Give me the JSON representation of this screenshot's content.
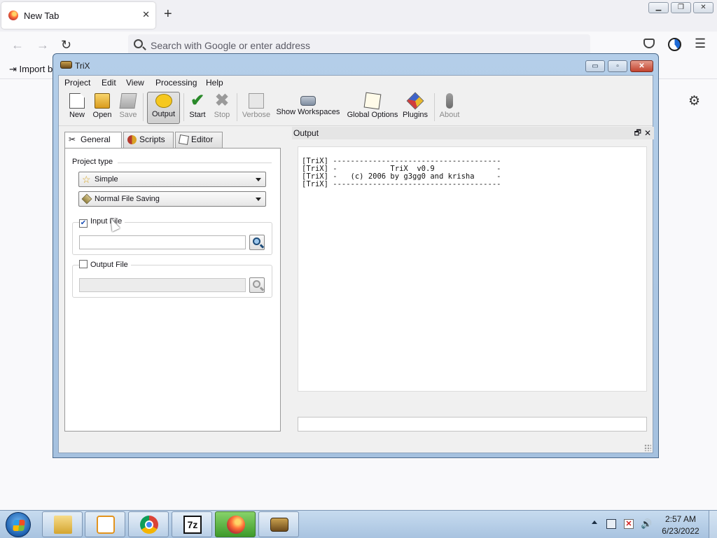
{
  "browser": {
    "tab_title": "New Tab",
    "tab_close": "✕",
    "new_tab": "+",
    "url_placeholder": "Search with Google or enter address",
    "import_bookmarks": "⇥ Import b"
  },
  "trix": {
    "title": "TriX",
    "window_controls": {
      "minimize": "▭",
      "maximize": "▫",
      "close": "✕"
    },
    "menu": [
      "Project",
      "Edit",
      "View",
      "Processing",
      "Help"
    ],
    "toolbar": {
      "new": "New",
      "open": "Open",
      "save": "Save",
      "output": "Output",
      "start": "Start",
      "stop": "Stop",
      "verbose": "Verbose",
      "show_workspaces": "Show Workspaces",
      "global_options": "Global Options",
      "plugins": "Plugins",
      "about": "About"
    },
    "tabs": {
      "general": "General",
      "scripts": "Scripts",
      "editor": "Editor"
    },
    "general": {
      "project_type_label": "Project type",
      "project_type_value": "Simple",
      "file_saving_value": "Normal File Saving",
      "input_file_label": "Input File",
      "input_file_checked": true,
      "input_file_value": "",
      "output_file_label": "Output File",
      "output_file_checked": false,
      "output_file_value": ""
    },
    "output": {
      "title": "Output",
      "float": "🗗",
      "close": "✕",
      "lines": "[TriX] --------------------------------------\n[TriX] -            TriX  v0.9              -\n[TriX] -   (c) 2006 by g3gg0 and krisha     -\n[TriX] --------------------------------------"
    }
  },
  "taskbar": {
    "apps": [
      "explorer",
      "media-player",
      "chrome",
      "7-zip",
      "firefox",
      "trix"
    ],
    "clock_time": "2:57 AM",
    "clock_date": "6/23/2022"
  }
}
